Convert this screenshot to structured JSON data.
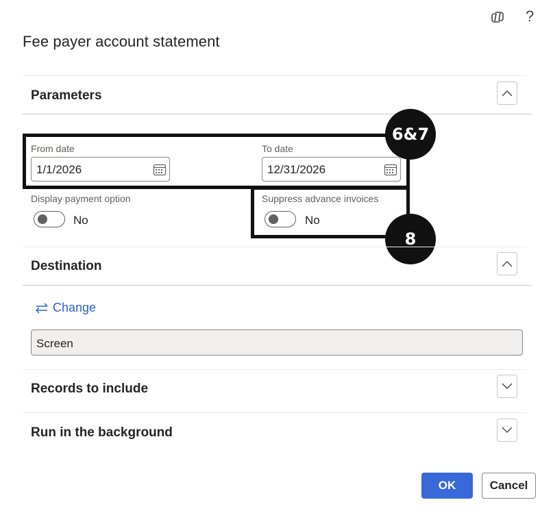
{
  "header": {
    "copilot_icon": "copilot-icon",
    "help_label": "?",
    "title": "Fee payer account statement"
  },
  "parameters": {
    "title": "Parameters",
    "from_date_label": "From date",
    "from_date_value": "1/1/2026",
    "to_date_label": "To date",
    "to_date_value": "12/31/2026",
    "display_payment_label": "Display payment option",
    "display_payment_value": "No",
    "suppress_advance_label": "Suppress advance invoices",
    "suppress_advance_value": "No"
  },
  "callouts": {
    "dates_badge": "6&7",
    "suppress_badge": "8"
  },
  "destination": {
    "title": "Destination",
    "change_label": "Change",
    "value": "Screen"
  },
  "records": {
    "title": "Records to include"
  },
  "background": {
    "title": "Run in the background"
  },
  "footer": {
    "ok_label": "OK",
    "cancel_label": "Cancel"
  },
  "colors": {
    "accent": "#3968d8",
    "link": "#2d62c9",
    "callout": "#111111"
  }
}
